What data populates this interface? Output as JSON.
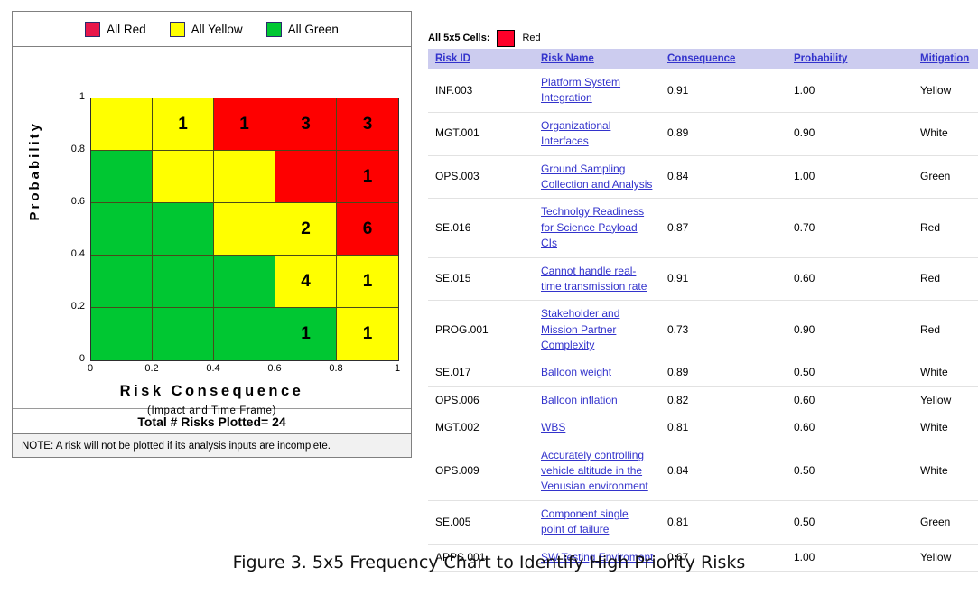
{
  "chart_panel": {
    "legend": [
      {
        "label": "All Red",
        "color": "#e8174b",
        "icon": "red-square-swatch"
      },
      {
        "label": "All Yellow",
        "color": "#ffff00",
        "icon": "yellow-square-swatch"
      },
      {
        "label": "All Green",
        "color": "#00c732",
        "icon": "green-square-swatch"
      }
    ],
    "y_axis_label": "Probability",
    "x_axis_label": "Risk Consequence",
    "x_axis_sublabel": "(Impact and Time Frame)",
    "y_ticks": [
      "1",
      "0.8",
      "0.6",
      "0.4",
      "0.2",
      "0"
    ],
    "x_ticks": [
      "0",
      "0.2",
      "0.4",
      "0.6",
      "0.8",
      "1"
    ],
    "total_label": "Total # Risks Plotted= 24",
    "note": "NOTE:  A risk will not be plotted if its analysis inputs are incomplete."
  },
  "chart_data": {
    "type": "heatmap",
    "title": "5x5 Frequency Chart to Identify High Priority Risks",
    "xlabel": "Risk Consequence",
    "ylabel": "Probability",
    "xlim": [
      0,
      1
    ],
    "ylim": [
      0,
      1
    ],
    "x_ticks": [
      0,
      0.2,
      0.4,
      0.6,
      0.8,
      1
    ],
    "y_ticks": [
      0,
      0.2,
      0.4,
      0.6,
      0.8,
      1
    ],
    "grid": true,
    "legend_position": "top",
    "legend_entries": [
      "All Red",
      "All Yellow",
      "All Green"
    ],
    "total_plotted": 24,
    "colors": {
      "red": "#fe0000",
      "yellow": "#ffff00",
      "green": "#00c732"
    },
    "cells": [
      [
        {
          "color": "yellow",
          "value": ""
        },
        {
          "color": "yellow",
          "value": "1"
        },
        {
          "color": "red",
          "value": "1"
        },
        {
          "color": "red",
          "value": "3"
        },
        {
          "color": "red",
          "value": "3"
        }
      ],
      [
        {
          "color": "green",
          "value": ""
        },
        {
          "color": "yellow",
          "value": ""
        },
        {
          "color": "yellow",
          "value": ""
        },
        {
          "color": "red",
          "value": ""
        },
        {
          "color": "red",
          "value": "1"
        }
      ],
      [
        {
          "color": "green",
          "value": ""
        },
        {
          "color": "green",
          "value": ""
        },
        {
          "color": "yellow",
          "value": ""
        },
        {
          "color": "yellow",
          "value": "2"
        },
        {
          "color": "red",
          "value": "6"
        }
      ],
      [
        {
          "color": "green",
          "value": ""
        },
        {
          "color": "green",
          "value": ""
        },
        {
          "color": "green",
          "value": ""
        },
        {
          "color": "yellow",
          "value": "4"
        },
        {
          "color": "yellow",
          "value": "1"
        }
      ],
      [
        {
          "color": "green",
          "value": ""
        },
        {
          "color": "green",
          "value": ""
        },
        {
          "color": "green",
          "value": ""
        },
        {
          "color": "green",
          "value": "1"
        },
        {
          "color": "yellow",
          "value": "1"
        }
      ]
    ]
  },
  "table_panel": {
    "cells_indicator_label": "All 5x5 Cells:",
    "cells_indicator_value": "Red",
    "cells_indicator_color": "#fe0029",
    "headers": [
      "Risk ID",
      "Risk Name",
      "Consequence",
      "Probability",
      "Mitigation"
    ],
    "rows": [
      {
        "id": "INF.003",
        "name": "Platform System Integration",
        "consequence": "0.91",
        "probability": "1.00",
        "mitigation": "Yellow"
      },
      {
        "id": "MGT.001",
        "name": "Organizational Interfaces",
        "consequence": "0.89",
        "probability": "0.90",
        "mitigation": "White"
      },
      {
        "id": "OPS.003",
        "name": "Ground Sampling Collection and Analysis",
        "consequence": "0.84",
        "probability": "1.00",
        "mitigation": "Green"
      },
      {
        "id": "SE.016",
        "name": "Technolgy Readiness for Science Payload CIs",
        "consequence": "0.87",
        "probability": "0.70",
        "mitigation": "Red"
      },
      {
        "id": "SE.015",
        "name": "Cannot handle real-time transmission rate",
        "consequence": "0.91",
        "probability": "0.60",
        "mitigation": "Red"
      },
      {
        "id": "PROG.001",
        "name": "Stakeholder and Mission Partner Complexity",
        "consequence": "0.73",
        "probability": "0.90",
        "mitigation": "Red"
      },
      {
        "id": "SE.017",
        "name": "Balloon weight",
        "consequence": "0.89",
        "probability": "0.50",
        "mitigation": "White"
      },
      {
        "id": "OPS.006",
        "name": "Balloon inflation",
        "consequence": "0.82",
        "probability": "0.60",
        "mitigation": "Yellow"
      },
      {
        "id": "MGT.002",
        "name": "WBS",
        "consequence": "0.81",
        "probability": "0.60",
        "mitigation": "White"
      },
      {
        "id": "OPS.009",
        "name": "Accurately controlling vehicle altitude in the Venusian environment",
        "consequence": "0.84",
        "probability": "0.50",
        "mitigation": "White"
      },
      {
        "id": "SE.005",
        "name": "Component single point of failure",
        "consequence": "0.81",
        "probability": "0.50",
        "mitigation": "Green"
      },
      {
        "id": "APPS.001",
        "name": "SW Testing Enviroment",
        "consequence": "0.67",
        "probability": "1.00",
        "mitigation": "Yellow"
      }
    ]
  },
  "caption": "Figure 3. 5x5 Frequency Chart to Identify High Priority Risks"
}
